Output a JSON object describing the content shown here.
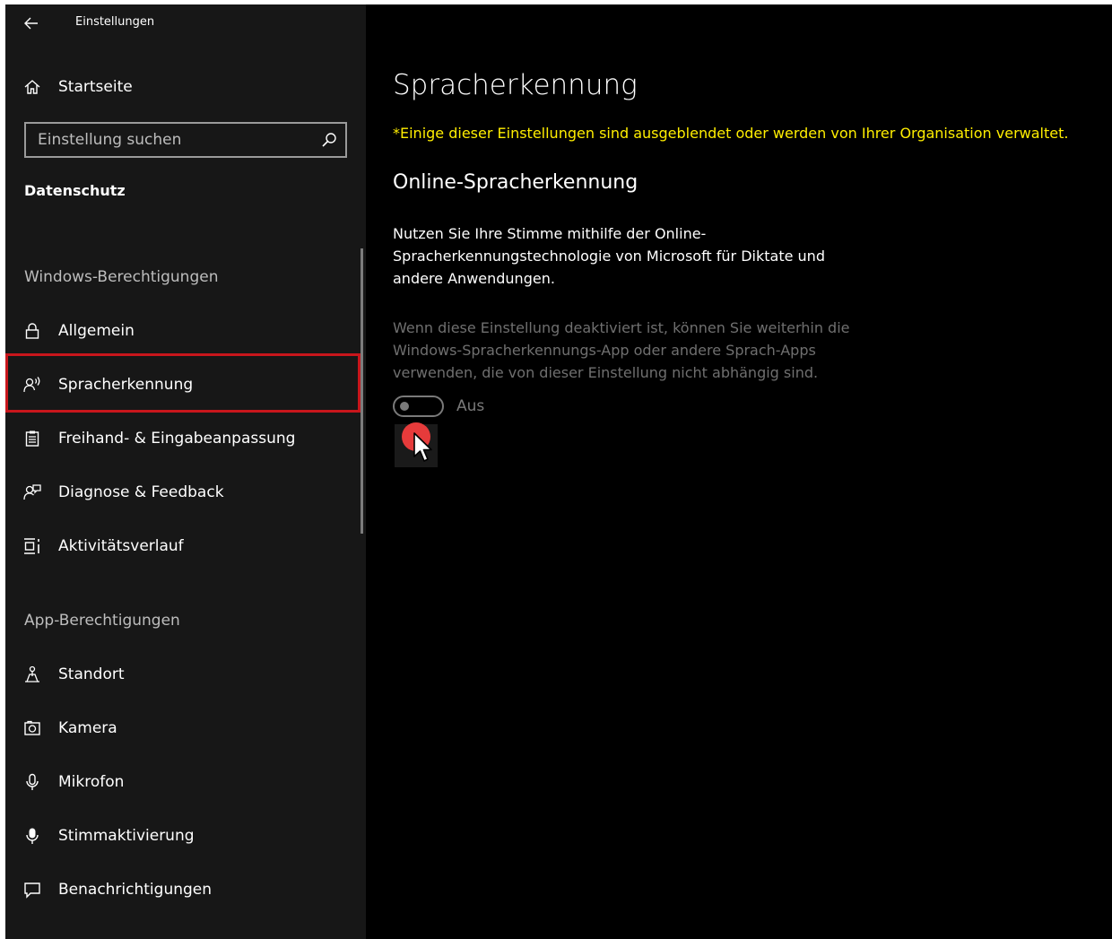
{
  "titlebar": {
    "back_icon": "back-arrow-icon",
    "app_title": "Einstellungen"
  },
  "sidebar": {
    "home": {
      "label": "Startseite",
      "icon": "home-icon"
    },
    "search": {
      "placeholder": "Einstellung suchen",
      "value": "",
      "icon": "search-icon"
    },
    "section_title": "Datenschutz",
    "groups": [
      {
        "header": "Windows-Berechtigungen",
        "items": [
          {
            "label": "Allgemein",
            "icon": "lock-icon"
          },
          {
            "label": "Spracherkennung",
            "icon": "speech-icon",
            "selected": true
          },
          {
            "label": "Freihand- & Eingabeanpassung",
            "icon": "clipboard-icon"
          },
          {
            "label": "Diagnose & Feedback",
            "icon": "diagnostics-icon"
          },
          {
            "label": "Aktivitätsverlauf",
            "icon": "timeline-icon"
          }
        ]
      },
      {
        "header": "App-Berechtigungen",
        "items": [
          {
            "label": "Standort",
            "icon": "location-icon"
          },
          {
            "label": "Kamera",
            "icon": "camera-icon"
          },
          {
            "label": "Mikrofon",
            "icon": "microphone-icon"
          },
          {
            "label": "Stimmaktivierung",
            "icon": "voice-activation-icon"
          },
          {
            "label": "Benachrichtigungen",
            "icon": "notification-icon"
          }
        ]
      }
    ]
  },
  "main": {
    "title": "Spracherkennung",
    "org_notice": "*Einige dieser Einstellungen sind ausgeblendet oder werden von Ihrer Organisation verwaltet.",
    "subheading": "Online-Spracherkennung",
    "description": "Nutzen Sie Ihre Stimme mithilfe der Online-Spracherkennungstechnologie von Microsoft für Diktate und andere Anwendungen.",
    "info": "Wenn diese Einstellung deaktiviert ist, können Sie weiterhin die Windows-Spracherkennungs-App oder andere Sprach-Apps verwenden, die von dieser Einstellung nicht abhängig sind.",
    "toggle": {
      "state": "off",
      "label": "Aus"
    }
  },
  "colors": {
    "accent_highlight": "#c8161c",
    "notice_text": "#ffee00",
    "click_marker": "#e63b3b",
    "sidebar_bg": "#171717",
    "main_bg": "#000000"
  }
}
